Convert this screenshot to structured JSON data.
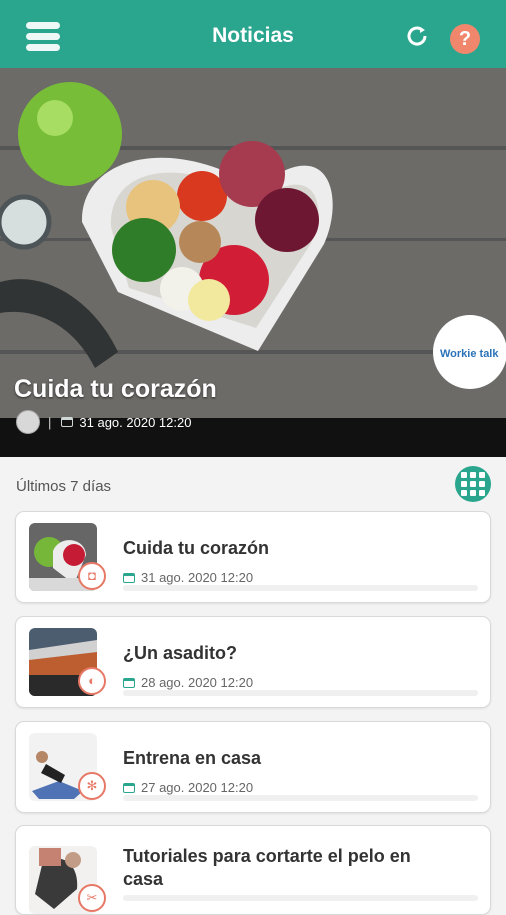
{
  "header": {
    "title": "Noticias"
  },
  "hero": {
    "title": "Cuida tu corazón",
    "date": "31 ago. 2020 12:20",
    "separator": "|",
    "logo_text": "Workie talk"
  },
  "feed": {
    "section_label": "Últimos 7 días"
  },
  "articles": [
    {
      "title": "Cuida tu corazón",
      "date": "31 ago. 2020 12:20",
      "badge_icon": "camera-icon"
    },
    {
      "title": "¿Un asadito?",
      "date": "28 ago. 2020 12:20",
      "badge_icon": "masks-icon"
    },
    {
      "title": "Entrena en casa",
      "date": "27 ago. 2020 12:20",
      "badge_icon": "fitness-icon"
    },
    {
      "title": "Tutoriales para cortarte el pelo en casa",
      "date": "",
      "badge_icon": "scissors-icon"
    }
  ],
  "colors": {
    "accent": "#2aa58e",
    "help": "#f0876d"
  }
}
